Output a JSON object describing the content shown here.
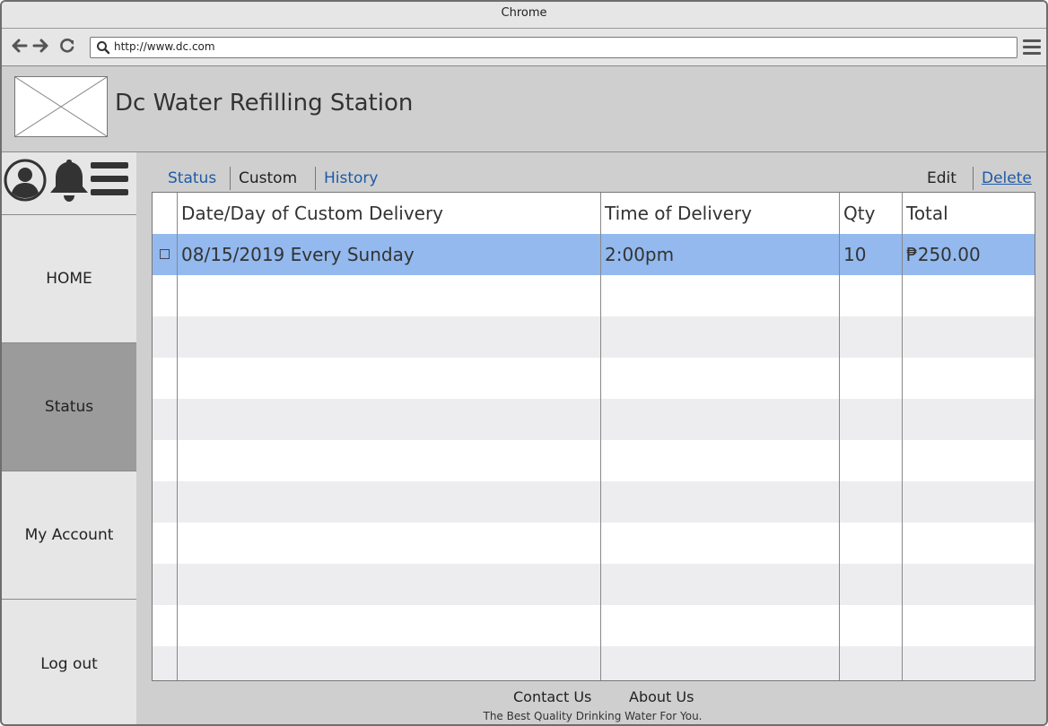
{
  "browser": {
    "title": "Chrome",
    "url": "http://www.dc.com"
  },
  "app": {
    "title": "Dc Water Refilling Station"
  },
  "sidebar": {
    "items": [
      {
        "label": "HOME"
      },
      {
        "label": "Status"
      },
      {
        "label": "My Account"
      },
      {
        "label": "Log out"
      }
    ],
    "active": "Status"
  },
  "tabs": {
    "status": "Status",
    "custom": "Custom",
    "history": "History",
    "active": "Custom"
  },
  "actions": {
    "edit": "Edit",
    "delete": "Delete"
  },
  "table": {
    "headers": [
      "Date/Day of Custom Delivery",
      "Time of Delivery",
      "Qty",
      "Total"
    ],
    "rows": [
      {
        "date": "08/15/2019 Every Sunday",
        "time": "2:00pm",
        "qty": "10",
        "total": "₱250.00",
        "checked": false
      }
    ]
  },
  "footer": {
    "contact": "Contact Us",
    "about": "About Us",
    "tagline": "The Best Quality Drinking Water For You."
  },
  "colors": {
    "selected_row": "#93b9ee",
    "link": "#1f5aa6",
    "sidebar_active": "#9c9b9c"
  }
}
